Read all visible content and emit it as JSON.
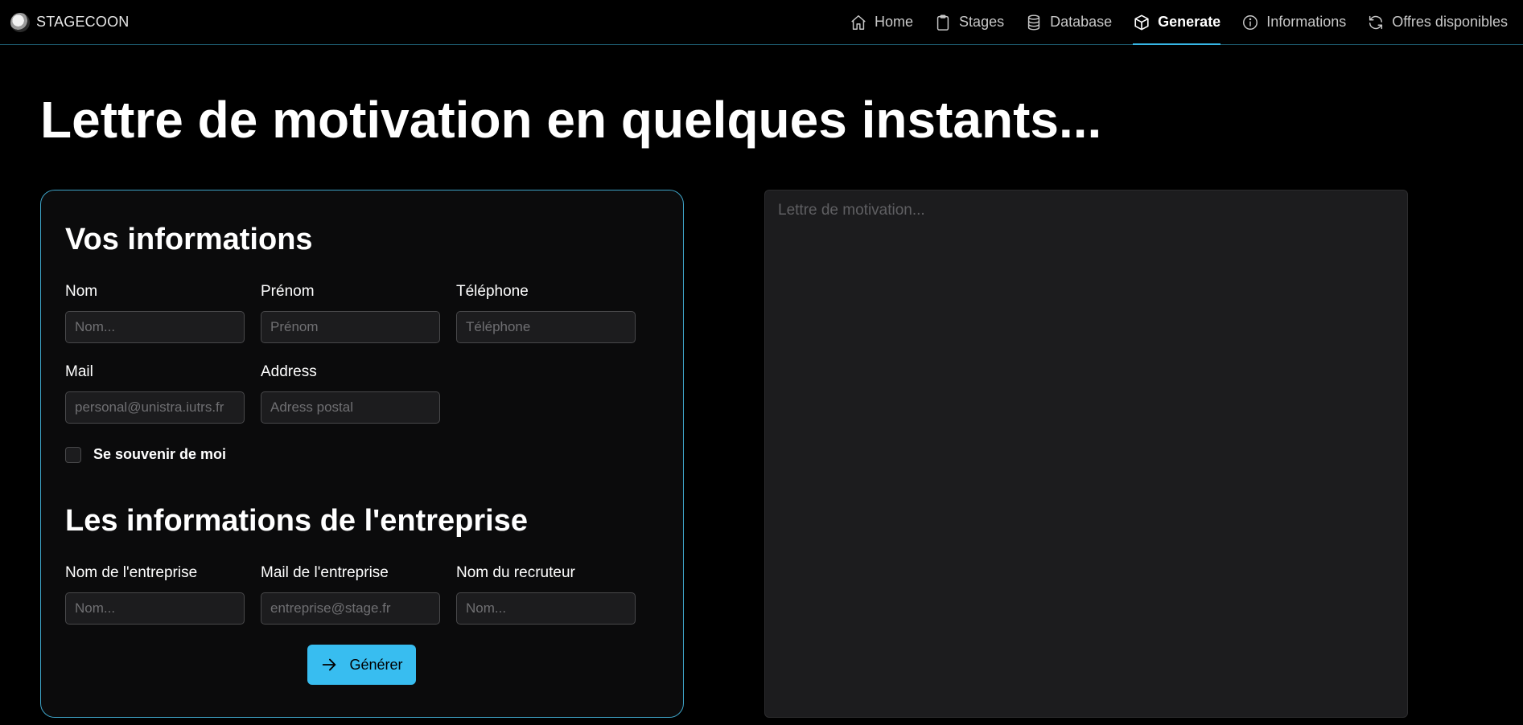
{
  "brand": {
    "name": "STAGECOON",
    "logo_icon": "raccoon-logo-icon"
  },
  "nav": {
    "items": [
      {
        "label": "Home",
        "icon": "home-icon"
      },
      {
        "label": "Stages",
        "icon": "clipboard-icon"
      },
      {
        "label": "Database",
        "icon": "database-icon"
      },
      {
        "label": "Generate",
        "icon": "cube-icon",
        "active": true
      },
      {
        "label": "Informations",
        "icon": "info-icon"
      },
      {
        "label": "Offres disponibles",
        "icon": "refresh-icon"
      }
    ]
  },
  "page": {
    "title": "Lettre de motivation en quelques instants..."
  },
  "personal": {
    "title": "Vos informations",
    "nom": {
      "label": "Nom",
      "placeholder": "Nom...",
      "value": ""
    },
    "prenom": {
      "label": "Prénom",
      "placeholder": "Prénom",
      "value": ""
    },
    "telephone": {
      "label": "Téléphone",
      "placeholder": "Téléphone",
      "value": ""
    },
    "mail": {
      "label": "Mail",
      "placeholder": "personal@unistra.iutrs.fr",
      "value": ""
    },
    "address": {
      "label": "Address",
      "placeholder": "Adress postal",
      "value": ""
    },
    "remember": {
      "label": "Se souvenir de moi",
      "checked": false
    }
  },
  "company": {
    "title": "Les informations de l'entreprise",
    "nom": {
      "label": "Nom de l'entreprise",
      "placeholder": "Nom...",
      "value": ""
    },
    "mail": {
      "label": "Mail de l'entreprise",
      "placeholder": "entreprise@stage.fr",
      "value": ""
    },
    "recruteur": {
      "label": "Nom du recruteur",
      "placeholder": "Nom...",
      "value": ""
    }
  },
  "submit": {
    "label": "Générer",
    "icon": "arrow-right-icon"
  },
  "letter": {
    "placeholder": "Lettre de motivation...",
    "value": ""
  },
  "colors": {
    "accent": "#38bdf0",
    "border": "#3ea4c8",
    "background": "#000000"
  }
}
